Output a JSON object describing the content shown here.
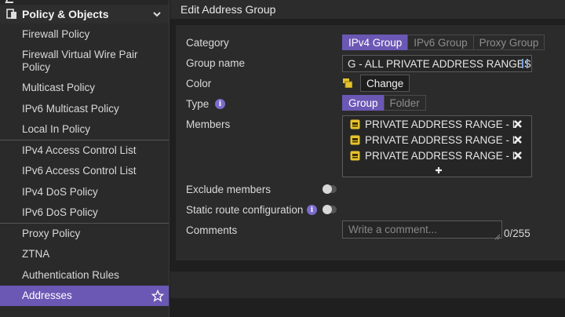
{
  "sidebar": {
    "section_title": "Policy & Objects",
    "items": [
      {
        "label": "Firewall Policy"
      },
      {
        "label": "Firewall Virtual Wire Pair Policy"
      },
      {
        "label": "Multicast Policy"
      },
      {
        "label": "IPv6 Multicast Policy"
      },
      {
        "label": "Local In Policy"
      },
      {
        "label": "IPv4 Access Control List"
      },
      {
        "label": "IPv6 Access Control List"
      },
      {
        "label": "IPv4 DoS Policy"
      },
      {
        "label": "IPv6 DoS Policy"
      },
      {
        "label": "Proxy Policy"
      },
      {
        "label": "ZTNA"
      },
      {
        "label": "Authentication Rules"
      },
      {
        "label": "Addresses"
      }
    ]
  },
  "dialog": {
    "title": "Edit Address Group",
    "labels": {
      "category": "Category",
      "group_name": "Group name",
      "color": "Color",
      "type": "Type",
      "members": "Members",
      "exclude_members": "Exclude members",
      "static_route": "Static route configuration",
      "comments": "Comments"
    },
    "category_options": [
      "IPv4 Group",
      "IPv6 Group",
      "Proxy Group"
    ],
    "category_selected": "IPv4 Group",
    "group_name_value": "G - ALL PRIVATE ADDRESS RANGES",
    "color_button": "Change",
    "type_options": [
      "Group",
      "Folder"
    ],
    "type_selected": "Group",
    "members": [
      "PRIVATE ADDRESS RANGE - LAN",
      "PRIVATE ADDRESS RANGE - LAN",
      "PRIVATE ADDRESS RANGE - LAN"
    ],
    "add_member_glyph": "+",
    "exclude_members_on": false,
    "static_route_on": false,
    "comments_placeholder": "Write a comment...",
    "comments_count": "0/255"
  },
  "colors": {
    "accent": "#6b58b5",
    "member_icon": "#e6c22e"
  }
}
